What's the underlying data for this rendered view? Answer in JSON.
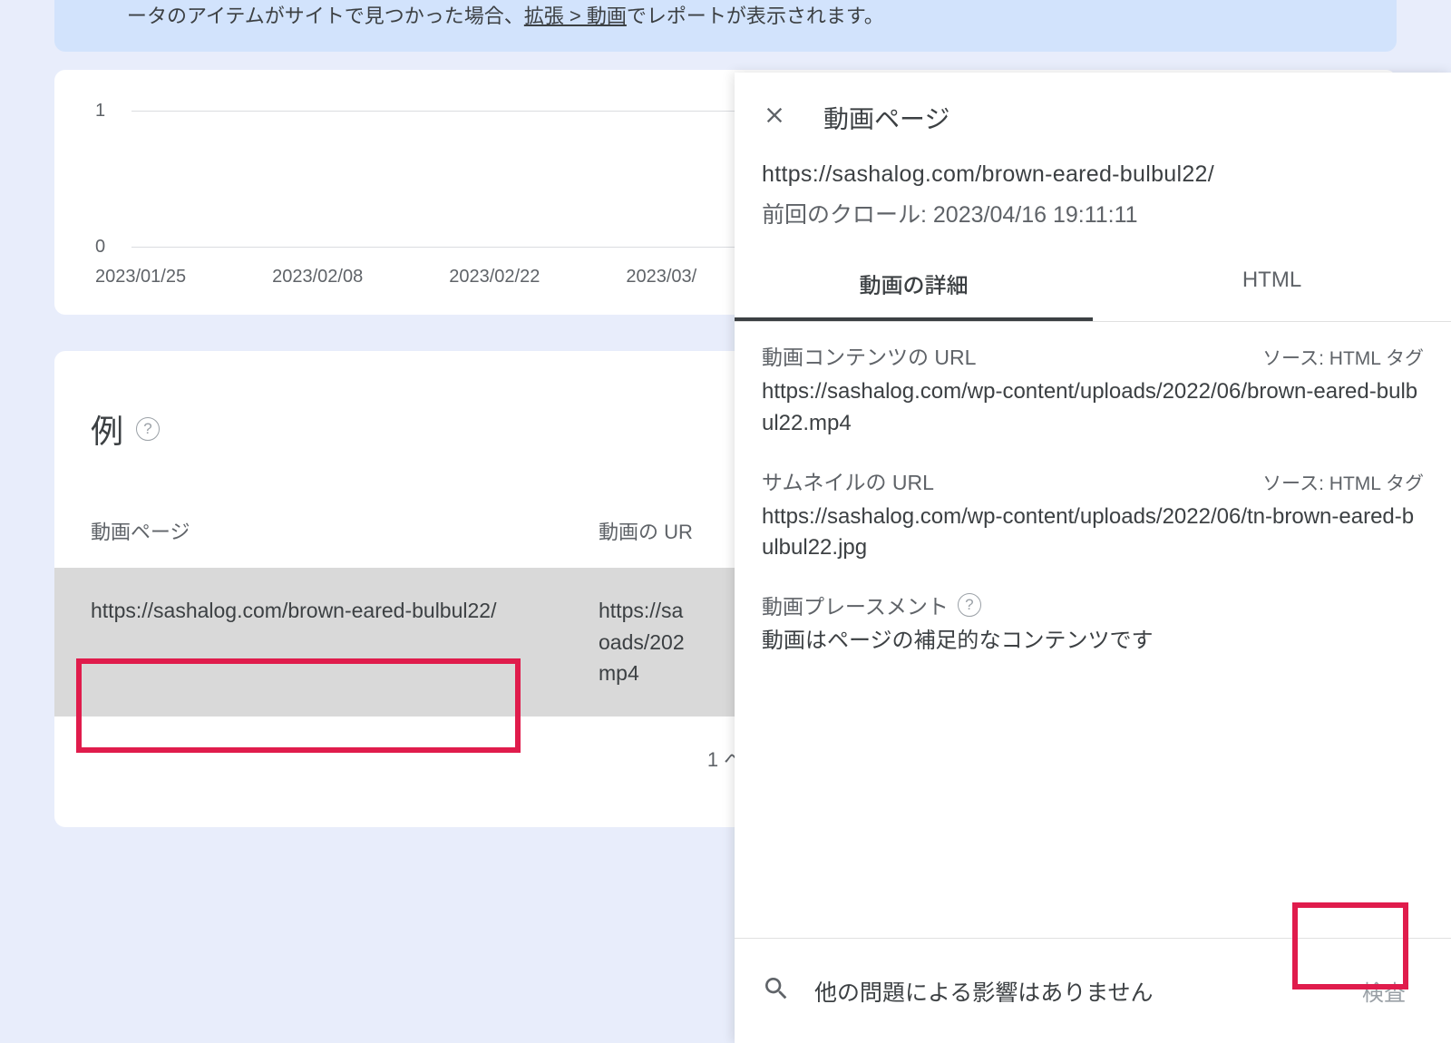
{
  "banner": {
    "prefix": "ータのアイテムがサイトで見つかった場合、",
    "link": "拡張 > 動画",
    "suffix": "でレポートが表示されます。"
  },
  "chart_data": {
    "type": "line",
    "x_ticks": [
      "2023/01/25",
      "2023/02/08",
      "2023/02/22",
      "2023/03/"
    ],
    "y_ticks": [
      "1",
      "0"
    ],
    "ylim": [
      0,
      1
    ],
    "series": [],
    "title": ""
  },
  "example": {
    "title": "例",
    "columns": {
      "page": "動画ページ",
      "url": "動画の UR"
    },
    "row": {
      "page": "https://sashalog.com/brown-eared-bulbul22/",
      "url": "https://sashalog.com/wp-content/uploads/2022/06/brown-eared-bulbul22.mp4",
      "url_truncated": "https://sa\noads/202\nmp4"
    },
    "pager": "1 ペ"
  },
  "panel": {
    "title": "動画ページ",
    "url": "https://sashalog.com/brown-eared-bulbul22/",
    "crawl_label": "前回のクロール: ",
    "crawl_value": "2023/04/16 19:11:11",
    "tabs": {
      "detail": "動画の詳細",
      "html": "HTML"
    },
    "content_url": {
      "label": "動画コンテンツの URL",
      "source": "ソース: HTML タグ",
      "value": "https://sashalog.com/wp-content/uploads/2022/06/brown-eared-bulbul22.mp4"
    },
    "thumbnail_url": {
      "label": "サムネイルの URL",
      "source": "ソース: HTML タグ",
      "value": "https://sashalog.com/wp-content/uploads/2022/06/tn-brown-eared-bulbul22.jpg"
    },
    "placement": {
      "label": "動画プレースメント",
      "value": "動画はページの補足的なコンテンツです"
    },
    "footer_text": "他の問題による影響はありません",
    "inspect": "検査"
  }
}
